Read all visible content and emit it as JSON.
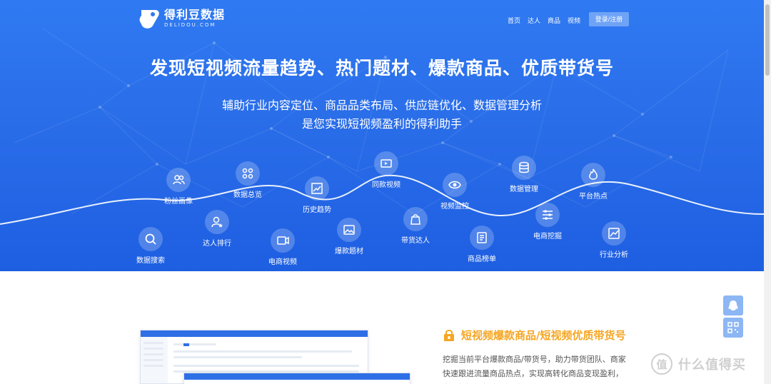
{
  "brand": {
    "name_cn": "得利豆数据",
    "name_en": "DELIDOU.COM"
  },
  "nav": {
    "items": [
      "首页",
      "达人",
      "商品",
      "视频"
    ],
    "login": "登录/注册"
  },
  "hero": {
    "headline": "发现短视频流量趋势、热门题材、爆款商品、优质带货号",
    "subline1": "辅助行业内容定位、商品品类布局、供应链优化、数据管理分析",
    "subline2": "是您实现短视频盈利的得利助手"
  },
  "features": {
    "fans": {
      "label": "粉丝画像",
      "icon": "users-icon"
    },
    "overview": {
      "label": "数据总览",
      "icon": "grid-icon"
    },
    "history": {
      "label": "历史趋势",
      "icon": "trend-icon"
    },
    "same_video": {
      "label": "同款视频",
      "icon": "video-icon"
    },
    "monitor": {
      "label": "视频监控",
      "icon": "eye-icon"
    },
    "data_mgmt": {
      "label": "数据管理",
      "icon": "database-icon"
    },
    "hot": {
      "label": "平台热点",
      "icon": "fire-icon"
    },
    "search": {
      "label": "数据搜索",
      "icon": "search-icon"
    },
    "talent_rank": {
      "label": "达人排行",
      "icon": "user-star-icon"
    },
    "ec_video": {
      "label": "电商视频",
      "icon": "video-icon"
    },
    "topic": {
      "label": "爆款题材",
      "icon": "image-icon"
    },
    "seller": {
      "label": "带货达人",
      "icon": "bag-icon"
    },
    "product_rank": {
      "label": "商品榜单",
      "icon": "list-icon"
    },
    "ec_mining": {
      "label": "电商挖掘",
      "icon": "filter-icon"
    },
    "industry": {
      "label": "行业分析",
      "icon": "chart-icon"
    }
  },
  "section": {
    "title": "短视频爆款商品/短视频优质带货号",
    "desc": "挖掘当前平台爆款商品/带货号，助力带货团队、商家快速跟进流量商品热点，实现高转化商品变现盈利，布局好短视频流量渠道"
  },
  "watermark": {
    "symbol": "值",
    "text": "什么值得买"
  },
  "colors": {
    "hero": "#2a6de8",
    "accent": "#f5a623",
    "float": "#8db6f4"
  }
}
